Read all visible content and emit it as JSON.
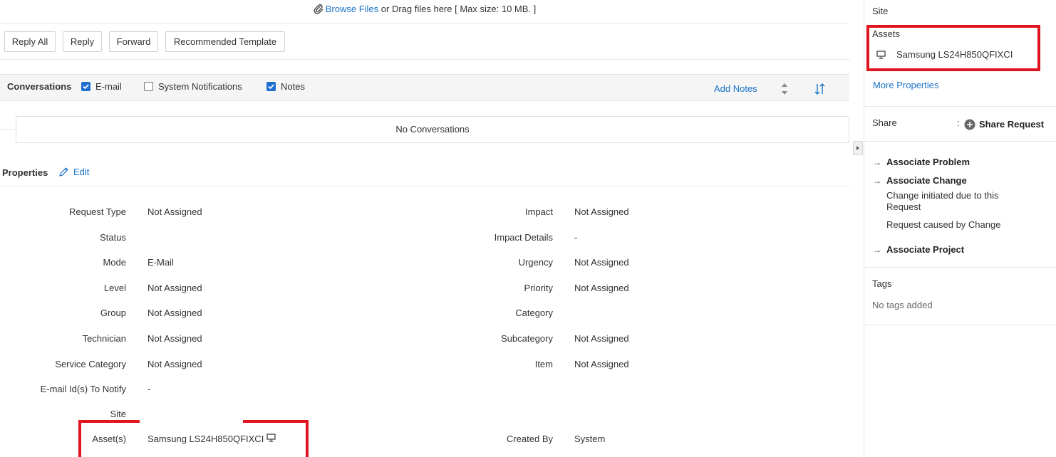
{
  "upload": {
    "link_text": "Browse Files",
    "rest_text": " or Drag files here [ Max size: 10 MB. ]"
  },
  "actions": {
    "reply_all": "Reply All",
    "reply": "Reply",
    "forward": "Forward",
    "recommended_template": "Recommended Template"
  },
  "conversations": {
    "title": "Conversations",
    "filters": [
      {
        "label": "E-mail",
        "checked": true
      },
      {
        "label": "System Notifications",
        "checked": false
      },
      {
        "label": "Notes",
        "checked": true
      }
    ],
    "add_notes": "Add Notes",
    "empty_text": "No Conversations"
  },
  "properties": {
    "title": "Properties",
    "edit": "Edit",
    "left": [
      {
        "label": "Request Type",
        "value": "Not Assigned"
      },
      {
        "label": "Status",
        "value": ""
      },
      {
        "label": "Mode",
        "value": "E-Mail"
      },
      {
        "label": "Level",
        "value": "Not Assigned"
      },
      {
        "label": "Group",
        "value": "Not Assigned"
      },
      {
        "label": "Technician",
        "value": "Not Assigned"
      },
      {
        "label": "Service Category",
        "value": "Not Assigned"
      },
      {
        "label": "E-mail Id(s) To Notify",
        "value": "-"
      },
      {
        "label": "Site",
        "value": ""
      },
      {
        "label": "Asset(s)",
        "value": "Samsung LS24H850QFIXCI"
      }
    ],
    "right": [
      {
        "label": "Impact",
        "value": "Not Assigned"
      },
      {
        "label": "Impact Details",
        "value": "-"
      },
      {
        "label": "Urgency",
        "value": "Not Assigned"
      },
      {
        "label": "Priority",
        "value": "Not Assigned"
      },
      {
        "label": "Category",
        "value": ""
      },
      {
        "label": "Subcategory",
        "value": "Not Assigned"
      },
      {
        "label": "Item",
        "value": "Not Assigned"
      },
      {
        "label": "Created By",
        "value": "System"
      }
    ]
  },
  "sidebar": {
    "site_label": "Site",
    "assets_label": "Assets",
    "asset_name": "Samsung LS24H850QFIXCI",
    "more_properties": "More Properties",
    "share_label": "Share",
    "share_colon": ":",
    "share_request": "Share Request",
    "associate_problem": "Associate Problem",
    "associate_change": "Associate Change",
    "change_initiated": "Change initiated due to this Request",
    "request_caused": "Request caused by Change",
    "associate_project": "Associate Project",
    "tags_label": "Tags",
    "no_tags": "No tags added"
  },
  "colors": {
    "accent": "#1a73c9",
    "highlight": "#e0141e",
    "checkbox": "#1e6fd0"
  }
}
